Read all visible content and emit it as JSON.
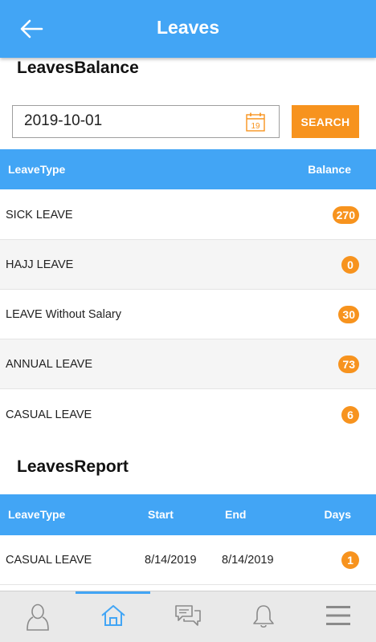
{
  "header": {
    "title": "Leaves"
  },
  "balance_section": {
    "title": "LeavesBalance",
    "date_value": "2019-10-01",
    "calendar_day": "19",
    "search_label": "SEARCH",
    "columns": {
      "type": "LeaveType",
      "balance": "Balance"
    },
    "rows": [
      {
        "type": "SICK LEAVE",
        "balance": "270"
      },
      {
        "type": "HAJJ LEAVE",
        "balance": "0"
      },
      {
        "type": "LEAVE Without Salary",
        "balance": "30"
      },
      {
        "type": "ANNUAL LEAVE",
        "balance": "73"
      },
      {
        "type": "CASUAL LEAVE",
        "balance": "6"
      }
    ]
  },
  "report_section": {
    "title": "LeavesReport",
    "columns": {
      "type": "LeaveType",
      "start": "Start",
      "end": "End",
      "days": "Days"
    },
    "rows": [
      {
        "type": "CASUAL LEAVE",
        "start": "8/14/2019",
        "end": "8/14/2019",
        "days": "1"
      }
    ]
  },
  "bottom_nav": {
    "items": [
      {
        "icon": "profile-icon"
      },
      {
        "icon": "home-icon",
        "active": true
      },
      {
        "icon": "chat-icon"
      },
      {
        "icon": "bell-icon"
      },
      {
        "icon": "menu-icon"
      }
    ]
  },
  "colors": {
    "primary": "#42a5f5",
    "accent": "#f7931e",
    "nav_background": "#e9e9e9"
  }
}
